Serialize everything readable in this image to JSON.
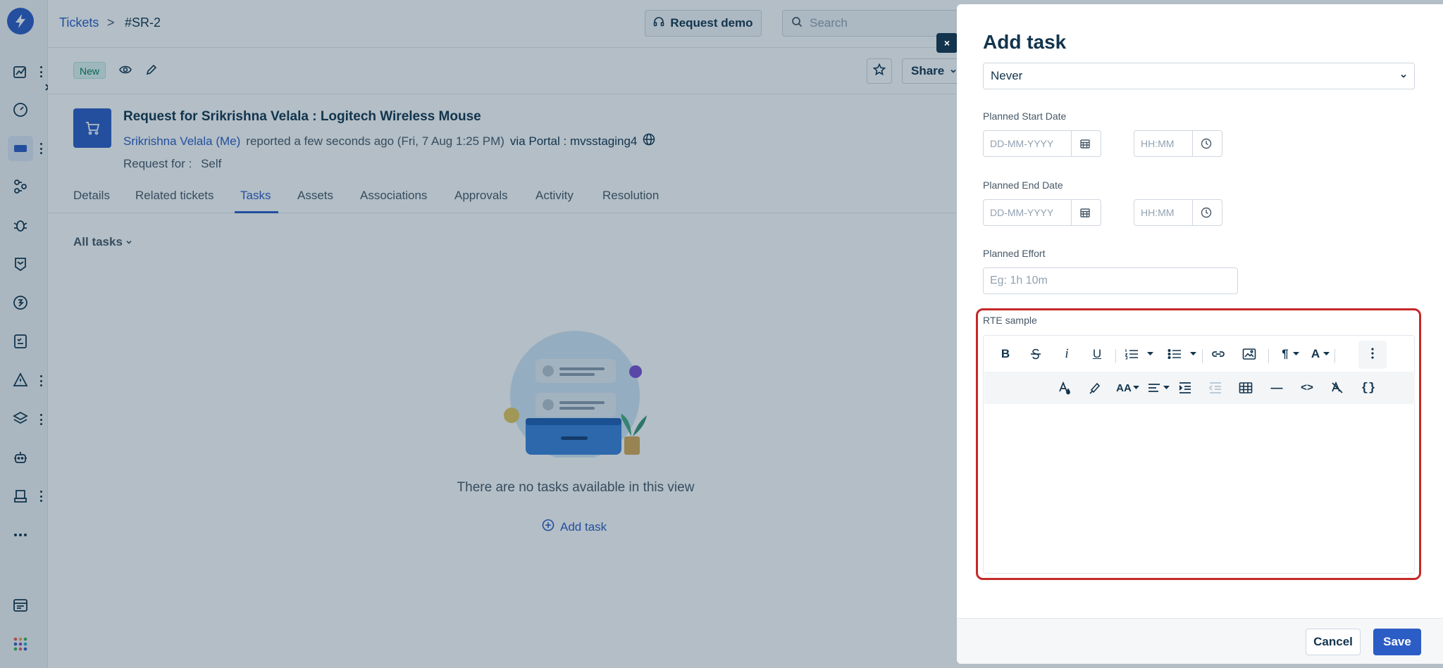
{
  "breadcrumb": {
    "parent": "Tickets",
    "separator": ">",
    "current": "#SR-2"
  },
  "topbar": {
    "request_demo": "Request demo",
    "search_placeholder": "Search"
  },
  "actionbar": {
    "status": "New",
    "share": "Share"
  },
  "ticket": {
    "title": "Request for Srikrishna Velala : Logitech Wireless Mouse",
    "requester": "Srikrishna Velala (Me)",
    "reported": "reported a few seconds ago (Fri, 7 Aug 1:25 PM)",
    "via": "via Portal : mvsstaging4",
    "request_for_label": "Request for :",
    "request_for_value": "Self"
  },
  "tabs": [
    {
      "label": "Details"
    },
    {
      "label": "Related tickets"
    },
    {
      "label": "Tasks",
      "active": true
    },
    {
      "label": "Assets"
    },
    {
      "label": "Associations"
    },
    {
      "label": "Approvals"
    },
    {
      "label": "Activity"
    },
    {
      "label": "Resolution"
    }
  ],
  "tasks_view": {
    "filter": "All tasks",
    "empty_message": "There are no tasks available in this view",
    "add_task": "Add task"
  },
  "drawer": {
    "close": "×",
    "title": "Add task",
    "repeat_value": "Never",
    "planned_start": {
      "label": "Planned Start Date",
      "date_placeholder": "DD-MM-YYYY",
      "time_placeholder": "HH:MM"
    },
    "planned_end": {
      "label": "Planned End Date",
      "date_placeholder": "DD-MM-YYYY",
      "time_placeholder": "HH:MM"
    },
    "planned_effort": {
      "label": "Planned Effort",
      "placeholder": "Eg: 1h 10m"
    },
    "rte": {
      "label": "RTE sample",
      "toolbar_row1": [
        "bold",
        "strikethrough",
        "italic",
        "underline",
        "ordered-list",
        "unordered-list",
        "link",
        "image",
        "paragraph-format",
        "font-family",
        "more"
      ],
      "toolbar_row2": [
        "text-color",
        "background-color",
        "font-size",
        "align",
        "indent",
        "outdent",
        "table",
        "horizontal-line",
        "code-view",
        "clear-formatting",
        "placeholders"
      ],
      "glyphs": {
        "bold": "B",
        "italic": "i",
        "underline": "U",
        "paragraph": "¶",
        "font": "A",
        "font_size": "AA",
        "placeholders": "{}",
        "code": "<>",
        "hr": "—"
      }
    },
    "footer": {
      "cancel": "Cancel",
      "save": "Save"
    }
  },
  "colors": {
    "primary": "#2c5cc5",
    "text": "#12344d",
    "highlight_border": "#c62828",
    "status_new_bg": "#e0f5f1"
  }
}
